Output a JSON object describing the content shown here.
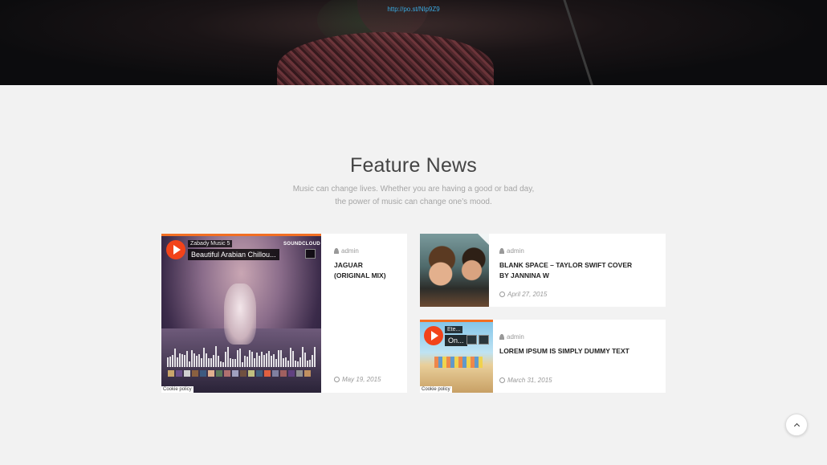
{
  "hero": {
    "link_text": "http://po.st/Nlp9Z9"
  },
  "section": {
    "title": "Feature News",
    "subtitle_line1": "Music can change lives. Whether you are having a good or bad day,",
    "subtitle_line2": "the power of music can change one’s mood."
  },
  "posts": [
    {
      "author": "admin",
      "title_line1": "JAGUAR",
      "title_line2": "(ORIGINAL MIX)",
      "date": "May 19, 2015",
      "player": {
        "artist": "Zabady Music 5",
        "track": "Beautiful Arabian Chillou...",
        "brand": "SOUNDCLOUD",
        "cookie": "Cookie policy"
      }
    },
    {
      "author": "admin",
      "title_line1": "BLANK SPACE – TAYLOR SWIFT COVER",
      "title_line2": "BY JANNINA W",
      "date": "April 27, 2015"
    },
    {
      "author": "admin",
      "title_line1": "LOREM IPSUM IS SIMPLY DUMMY TEXT",
      "date": "March 31, 2015",
      "player": {
        "artist": "Ete...",
        "track": "On...",
        "cookie": "Cookie policy"
      }
    }
  ],
  "colors": {
    "accent_link": "#3aa9e0",
    "soundcloud_orange": "#f26f23",
    "play_red": "#f2431a"
  },
  "icons": {
    "author": "user-icon",
    "date": "clock-icon",
    "scroll": "chevron-up-icon",
    "share": "share-icon",
    "download": "download-icon"
  }
}
